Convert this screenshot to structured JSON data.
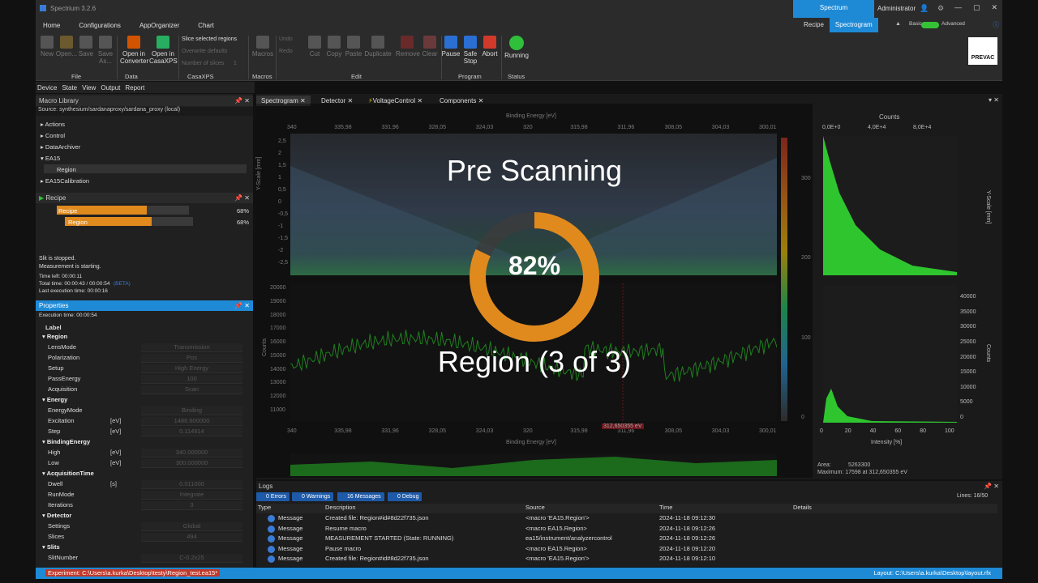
{
  "window": {
    "title": "Spectrium 3.2.6",
    "ribbon_tab_highlight": "Spectrum",
    "user": "Administrator",
    "controls": [
      "—",
      "▢",
      "✕"
    ]
  },
  "menu": {
    "items": [
      "Home",
      "Configurations",
      "AppOrganizer",
      "Chart"
    ],
    "context_tabs": [
      "Recipe",
      "Spectrogram"
    ],
    "basic_label": "Basic",
    "advanced_label": "Advanced"
  },
  "ribbon": {
    "file_buttons": [
      "New",
      "Open...",
      "Save",
      "Save As..."
    ],
    "data_buttons": [
      "Open in Converter",
      "Open in CasaXPS"
    ],
    "casaxps": {
      "slice_label": "Slice selected regions",
      "overwrite_label": "Overwrite defaults",
      "slices_label": "Number of slices",
      "slices_value": "1"
    },
    "macros_button": "Macros",
    "undo": "Undo",
    "redo": "Redo",
    "edit_buttons": [
      "Cut",
      "Copy",
      "Paste",
      "Duplicate",
      "Remove",
      "Clear"
    ],
    "program_buttons": [
      "Pause",
      "Safe Stop",
      "Abort"
    ],
    "status_button": "Running",
    "groups": [
      "File",
      "Data",
      "CasaXPS",
      "Macros",
      "Edit",
      "Program",
      "Status"
    ],
    "logo": "PREVAC"
  },
  "view_menu": [
    "Device",
    "State",
    "View",
    "Output",
    "Report"
  ],
  "macro_library": {
    "title": "Macro Library",
    "source": "Source: synthesium/sardanaproxy/sardana_proxy (local)",
    "items": [
      "Actions",
      "Control",
      "DataArchiver",
      "EA15",
      "Region",
      "EA15Calibration"
    ]
  },
  "recipe": {
    "title": "Recipe",
    "rows": [
      {
        "label": "Recipe",
        "pct": "68%",
        "progress": 0.68
      },
      {
        "label": "Region",
        "pct": "68%",
        "progress": 0.68
      }
    ],
    "status_lines": [
      "Slit is stopped.",
      "Measurement is starting.",
      "Time left: 00:00:11",
      "Total time: 00:00:43 / 00:00:54",
      "Last execution time: 00:00:16"
    ],
    "beta": "(BETA)"
  },
  "properties": {
    "title": "Properties",
    "exec_time": "Execution time: 00:00:54",
    "label": "Label",
    "groups": [
      {
        "name": "Region",
        "rows": [
          {
            "k": "LensMode",
            "u": "",
            "v": "Transmission"
          },
          {
            "k": "Polarization",
            "u": "",
            "v": "Pos"
          },
          {
            "k": "Setup",
            "u": "",
            "v": "High Energy"
          },
          {
            "k": "PassEnergy",
            "u": "",
            "v": "100"
          },
          {
            "k": "Acquisition",
            "u": "",
            "v": "Scan"
          }
        ]
      },
      {
        "name": "Energy",
        "rows": [
          {
            "k": "EnergyMode",
            "u": "",
            "v": "Binding"
          },
          {
            "k": "Excitation",
            "u": "[eV]",
            "v": "1486.600000"
          },
          {
            "k": "Step",
            "u": "[eV]",
            "v": "0.114914"
          }
        ]
      },
      {
        "name": "BindingEnergy",
        "rows": [
          {
            "k": "High",
            "u": "[eV]",
            "v": "340.000000"
          },
          {
            "k": "Low",
            "u": "[eV]",
            "v": "300.000000"
          }
        ]
      },
      {
        "name": "AcquisitionTime",
        "rows": [
          {
            "k": "Dwell",
            "u": "[s]",
            "v": "0.011000"
          },
          {
            "k": "RunMode",
            "u": "",
            "v": "Integrate"
          },
          {
            "k": "Iterations",
            "u": "",
            "v": "3"
          }
        ]
      },
      {
        "name": "Detector",
        "rows": [
          {
            "k": "Settings",
            "u": "",
            "v": "Global"
          },
          {
            "k": "Slices",
            "u": "",
            "v": "494"
          }
        ]
      },
      {
        "name": "Slits",
        "rows": [
          {
            "k": "SlitNumber",
            "u": "",
            "v": "C-0.2x25"
          }
        ]
      }
    ]
  },
  "doc_tabs": [
    "Spectrogram",
    "Detector",
    "VoltageControl",
    "Components"
  ],
  "chart_data": [
    {
      "type": "heatmap",
      "xlabel": "Binding Energy [eV]",
      "ylabel": "Y-Scale [mm]",
      "x_ticks": [
        "340",
        "335,98",
        "331,96",
        "328,05",
        "324,03",
        "320",
        "315,98",
        "311,96",
        "308,05",
        "304,03",
        "300,01"
      ],
      "y_ticks": [
        "2,5",
        "2",
        "1,5",
        "1",
        "0,5",
        "0",
        "-0,5",
        "-1",
        "-1,5",
        "-2",
        "-2,5"
      ],
      "colorbar_ticks": [
        "300",
        "200",
        "100",
        "0"
      ]
    },
    {
      "type": "line",
      "xlabel": "Binding Energy [eV]",
      "ylabel": "Counts",
      "x_ticks": [
        "340",
        "335,98",
        "331,96",
        "328,05",
        "324,03",
        "320",
        "315,98",
        "311,96",
        "308,05",
        "304,03",
        "300,01"
      ],
      "y_ticks": [
        "20000",
        "19000",
        "18000",
        "17000",
        "16000",
        "15000",
        "14000",
        "13000",
        "12000",
        "11000"
      ],
      "ylim": [
        11000,
        20000
      ],
      "cursor_label": "312,650355 eV"
    },
    {
      "type": "area",
      "title": "Counts",
      "x_ticks": [
        "0,0E+0",
        "4,0E+4",
        "8,0E+4"
      ],
      "ylabel": "Y-Scale [mm]"
    },
    {
      "type": "area",
      "xlabel": "Intensity [%]",
      "ylabel": "Counts",
      "x_ticks": [
        "0",
        "20",
        "40",
        "60",
        "80",
        "100"
      ],
      "y_ticks": [
        "40000",
        "35000",
        "30000",
        "25000",
        "20000",
        "15000",
        "10000",
        "5000",
        "0"
      ]
    }
  ],
  "readout": {
    "area": "Area:",
    "area_value": "5263300",
    "maximum": "Maximum: 17598 at 312,650355 eV"
  },
  "overlay": {
    "heading": "Pre Scanning",
    "percent_text": "82%",
    "progress": 0.82,
    "region_text": "Region (3 of 3)"
  },
  "logs": {
    "title": "Logs",
    "chips": [
      "0 Errors",
      "0 Warnings",
      "16 Messages",
      "0 Debug"
    ],
    "lines_label": "Lines: 16/50",
    "columns": [
      "Type",
      "Description",
      "Source",
      "Time",
      "Details"
    ],
    "rows": [
      {
        "type": "Message",
        "desc": "Created file: Region#id#8d22f735.json",
        "src": "<macro 'EA15.Region'>",
        "time": "2024-11-18 09:12:30"
      },
      {
        "type": "Message",
        "desc": "Resume macro",
        "src": "<macro EA15.Region>",
        "time": "2024-11-18 09:12:26"
      },
      {
        "type": "Message",
        "desc": "MEASUREMENT STARTED (State: RUNNING)",
        "src": "ea15/instrument/analyzercontrol",
        "time": "2024-11-18 09:12:26"
      },
      {
        "type": "Message",
        "desc": "Pause macro",
        "src": "<macro EA15.Region>",
        "time": "2024-11-18 09:12:20"
      },
      {
        "type": "Message",
        "desc": "Created file: Region#id#8d22f735.json",
        "src": "<macro 'EA15.Region'>",
        "time": "2024-11-18 09:12:10"
      }
    ]
  },
  "statusbar": {
    "experiment": "Experiment: C:\\Users\\a.kurka\\Desktop\\testy\\Region_test.ea15*",
    "layout": "Layout: C:\\Users\\a.kurka\\Desktop\\layout.rfx"
  },
  "colors": {
    "accent": "#1e8ad6",
    "progress": "#e08a1e",
    "plot_green": "#2fc52f",
    "error": "#c0392b"
  }
}
